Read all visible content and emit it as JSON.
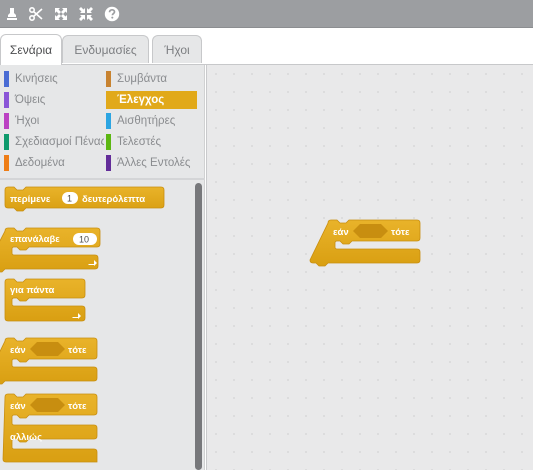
{
  "toolbar": {
    "icons": [
      "stamp-icon",
      "scissors-icon",
      "grow-icon",
      "shrink-icon",
      "help-icon"
    ]
  },
  "tabs": [
    {
      "label": "Σενάρια",
      "active": true
    },
    {
      "label": "Ενδυμασίες",
      "active": false
    },
    {
      "label": "Ήχοι",
      "active": false
    }
  ],
  "categories": [
    {
      "label": "Κινήσεις",
      "color": "#4a6cd4"
    },
    {
      "label": "Συμβάντα",
      "color": "#c88330"
    },
    {
      "label": "Όψεις",
      "color": "#8a55d7"
    },
    {
      "label": "Έλεγχος",
      "color": "#e1a91a",
      "selected": true
    },
    {
      "label": "Ήχοι",
      "color": "#bb42c3"
    },
    {
      "label": "Αισθητήρες",
      "color": "#2ca5e2"
    },
    {
      "label": "Σχεδιασμοί Πένας",
      "color": "#0e9a6c"
    },
    {
      "label": "Τελεστές",
      "color": "#5cb712"
    },
    {
      "label": "Δεδομένα",
      "color": "#ee7d16"
    },
    {
      "label": "Άλλες Εντολές",
      "color": "#632d99"
    }
  ],
  "palette_blocks": {
    "wait": {
      "label_before": "περίμενε",
      "value": "1",
      "label_after": "δευτερόλεπτα"
    },
    "repeat": {
      "label": "επανάλαβε",
      "value": "10"
    },
    "forever": {
      "label": "για πάντα"
    },
    "if_then": {
      "label_if": "εάν",
      "label_then": "τότε"
    },
    "if_else": {
      "label_if": "εάν",
      "label_then": "τότε",
      "label_else": "αλλιώς"
    }
  },
  "script_blocks": {
    "if_then": {
      "label_if": "εάν",
      "label_then": "τότε"
    }
  },
  "colors": {
    "control_block": "#e1a91a",
    "control_block_dark": "#c88e10"
  }
}
